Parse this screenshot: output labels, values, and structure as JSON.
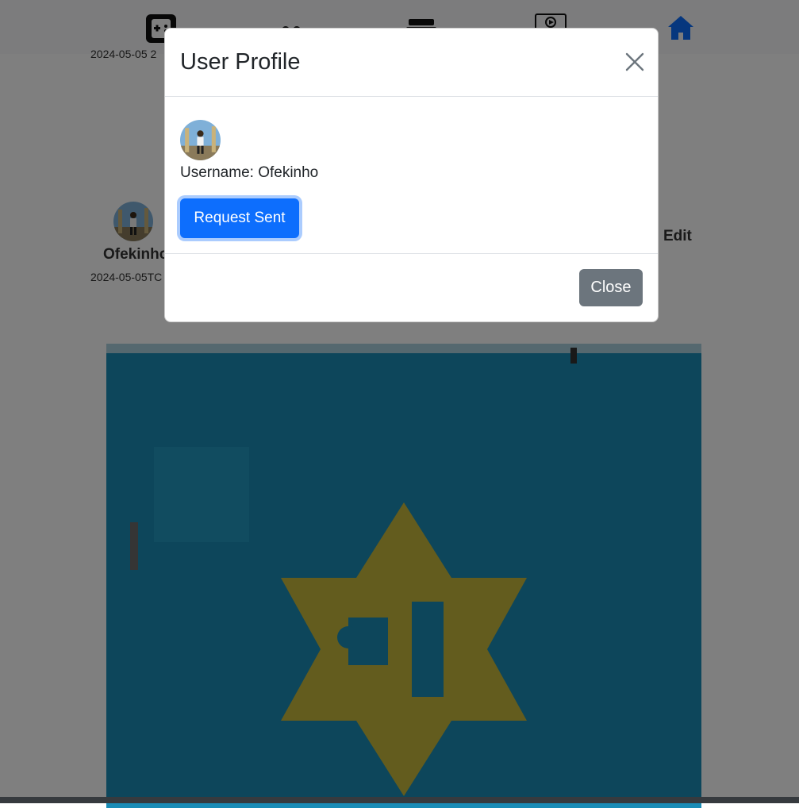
{
  "nav": {
    "icons": [
      "gamepad-icon",
      "flower-icon",
      "ship-icon",
      "video-icon",
      "home-icon"
    ],
    "active_color": "#0d6efd"
  },
  "feed": {
    "first_post": {
      "date": "2024-05-05 2"
    },
    "second_post": {
      "author": "Ofekinho",
      "date": "2024-05-05TC",
      "edit_label": "Edit"
    }
  },
  "modal": {
    "title": "User Profile",
    "username_label": "Username: Ofekinho",
    "request_button": "Request Sent",
    "close_button": "Close"
  },
  "colors": {
    "primary": "#0d6efd",
    "secondary": "#6c757d",
    "backdrop": "rgba(0,0,0,0.5)"
  }
}
